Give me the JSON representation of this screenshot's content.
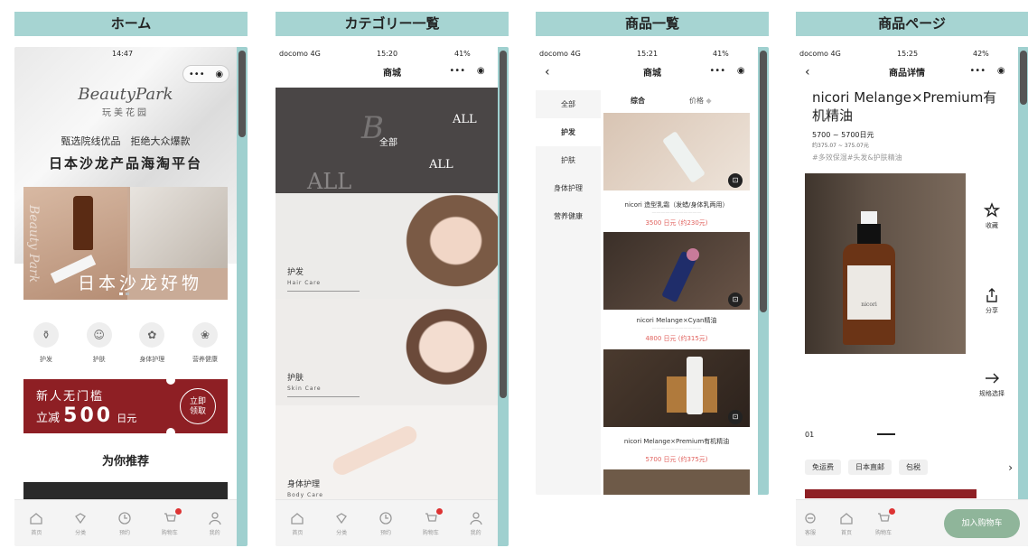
{
  "headers": {
    "home": "ホーム",
    "category": "カテゴリー一覧",
    "product_list": "商品一覧",
    "product_page": "商品ページ"
  },
  "home": {
    "status_time": "14:47",
    "brand_logo": "BeautyPark",
    "brand_cn": "玩美花园",
    "slogan1": "甄选院线优品　拒绝大众爆款",
    "slogan2": "日本沙龙产品海淘平台",
    "banner_text": "日本沙龙好物",
    "banner_side": "Beauty Park",
    "categories": [
      {
        "icon": "bottle-icon",
        "label": "护发"
      },
      {
        "icon": "face-icon",
        "label": "护肤"
      },
      {
        "icon": "body-icon",
        "label": "身体护理"
      },
      {
        "icon": "supplement-icon",
        "label": "营养健康"
      }
    ],
    "coupon_line1": "新人无门槛",
    "coupon_line2_prefix": "立减",
    "coupon_amount": "500",
    "coupon_unit": "日元",
    "coupon_button1": "立即",
    "coupon_button2": "领取",
    "recommend_title": "为你推荐"
  },
  "tabbar": [
    {
      "icon": "home-icon",
      "label": "首页"
    },
    {
      "icon": "category-icon",
      "label": "分类"
    },
    {
      "icon": "clock-icon",
      "label": "预约"
    },
    {
      "icon": "cart-icon",
      "label": "购物车"
    },
    {
      "icon": "user-icon",
      "label": "我的"
    }
  ],
  "category": {
    "status_carrier": "docomo 4G",
    "status_time": "15:20",
    "status_battery": "41%",
    "title": "商城",
    "all_label": "全部",
    "all_big": "ALL",
    "items": [
      {
        "label": "护发",
        "sub": "Hair Care"
      },
      {
        "label": "护肤",
        "sub": "Skin Care"
      },
      {
        "label": "身体护理",
        "sub": "Body Care"
      }
    ]
  },
  "product_list": {
    "status_carrier": "docomo 4G",
    "status_time": "15:21",
    "status_battery": "41%",
    "title": "商城",
    "sort_tabs": [
      "综合",
      "价格"
    ],
    "sidebar": [
      "全部",
      "护发",
      "护肤",
      "身体护理",
      "营养健康"
    ],
    "products": [
      {
        "name": "nicori 造型乳霜（发蜡/身体乳两用）",
        "price": "3500 日元 (约230元)"
      },
      {
        "name": "nicori Melange×Cyan精油",
        "price": "4800 日元 (约315元)"
      },
      {
        "name": "nicori Melange×Premium有机精油",
        "price": "5700 日元 (约375元)"
      }
    ]
  },
  "product_page": {
    "status_carrier": "docomo 4G",
    "status_time": "15:25",
    "status_battery": "42%",
    "title": "商品详情",
    "product_name": "nicori Melange×Premium有机精油",
    "price_range": "5700 ~ 5700日元",
    "price_cny": "约375.07 ~ 375.07元",
    "tags": "#多效保湿#头发&护肤精油",
    "actions": [
      {
        "icon": "star-icon",
        "label": "收藏"
      },
      {
        "icon": "share-icon",
        "label": "分享"
      },
      {
        "icon": "arrow-right-icon",
        "label": "规格选择"
      }
    ],
    "image_index": "01",
    "bottle_brand": "nicori",
    "badges": [
      "免运费",
      "日本直邮",
      "包税"
    ],
    "bottom_tabs": [
      {
        "icon": "service-icon",
        "label": "客服"
      },
      {
        "icon": "home-icon",
        "label": "首页"
      },
      {
        "icon": "cart-icon",
        "label": "购物车"
      }
    ],
    "add_to_cart": "加入购物车"
  },
  "colors": {
    "header_bg": "#a6d4d2",
    "coupon": "#8e1f24",
    "price": "#e0605c",
    "cart_button": "#8fb59a"
  }
}
